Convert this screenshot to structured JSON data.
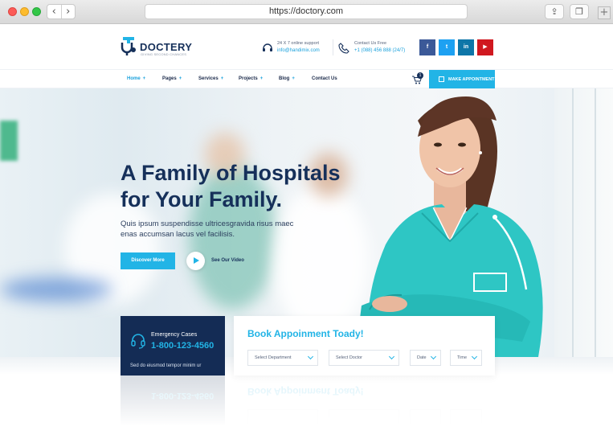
{
  "browser": {
    "url": "https://doctory.com",
    "back_icon": "chevron-left-icon",
    "forward_icon": "chevron-right-icon",
    "share_icon": "share-icon",
    "tabs_icon": "tabs-icon",
    "new_tab_icon": "plus-icon"
  },
  "header": {
    "logo_name": "DOCTERY",
    "logo_tagline": "GIVING SECOND CHANCES",
    "support_label": "24 X 7 online support",
    "support_email": "info@handimix.com",
    "contact_label": "Contact Us Free",
    "contact_phone": "+1 (088) 456 888 (24/7)",
    "social": [
      {
        "name": "facebook",
        "glyph": "f",
        "color": "#3b5998"
      },
      {
        "name": "twitter",
        "glyph": "t",
        "color": "#1da1f2"
      },
      {
        "name": "linkedin",
        "glyph": "in",
        "color": "#0e76a8"
      },
      {
        "name": "youtube",
        "glyph": "▶",
        "color": "#d0181f"
      }
    ]
  },
  "nav": {
    "items": [
      {
        "label": "Home",
        "active": true
      },
      {
        "label": "Pages",
        "active": false
      },
      {
        "label": "Services",
        "active": false
      },
      {
        "label": "Projects",
        "active": false
      },
      {
        "label": "Blog",
        "active": false
      },
      {
        "label": "Contact Us",
        "active": false
      }
    ],
    "cart_count": "1",
    "appointment_button": "MAKE APPOINTMENT"
  },
  "hero": {
    "title_line1": "A Family of Hospitals",
    "title_line2": "for Your Family.",
    "subtitle_line1": "Quis ipsum suspendisse ultricesgravida risus maec",
    "subtitle_line2": "enas accumsan lacus vel facilisis.",
    "discover_button": "Discover More",
    "video_label": "See Our Video"
  },
  "emergency": {
    "label": "Emergency Cases",
    "phone": "1-800-123-4560",
    "text": "Sed do eiusmod tempor minim ur"
  },
  "booking": {
    "title": "Book Appoinment Toady!",
    "fields": [
      {
        "label": "Select Department"
      },
      {
        "label": "Select Doctor"
      },
      {
        "label": "Date"
      },
      {
        "label": "Time"
      }
    ]
  },
  "colors": {
    "accent": "#22b4e6",
    "navy": "#142c55",
    "title": "#16305a"
  }
}
